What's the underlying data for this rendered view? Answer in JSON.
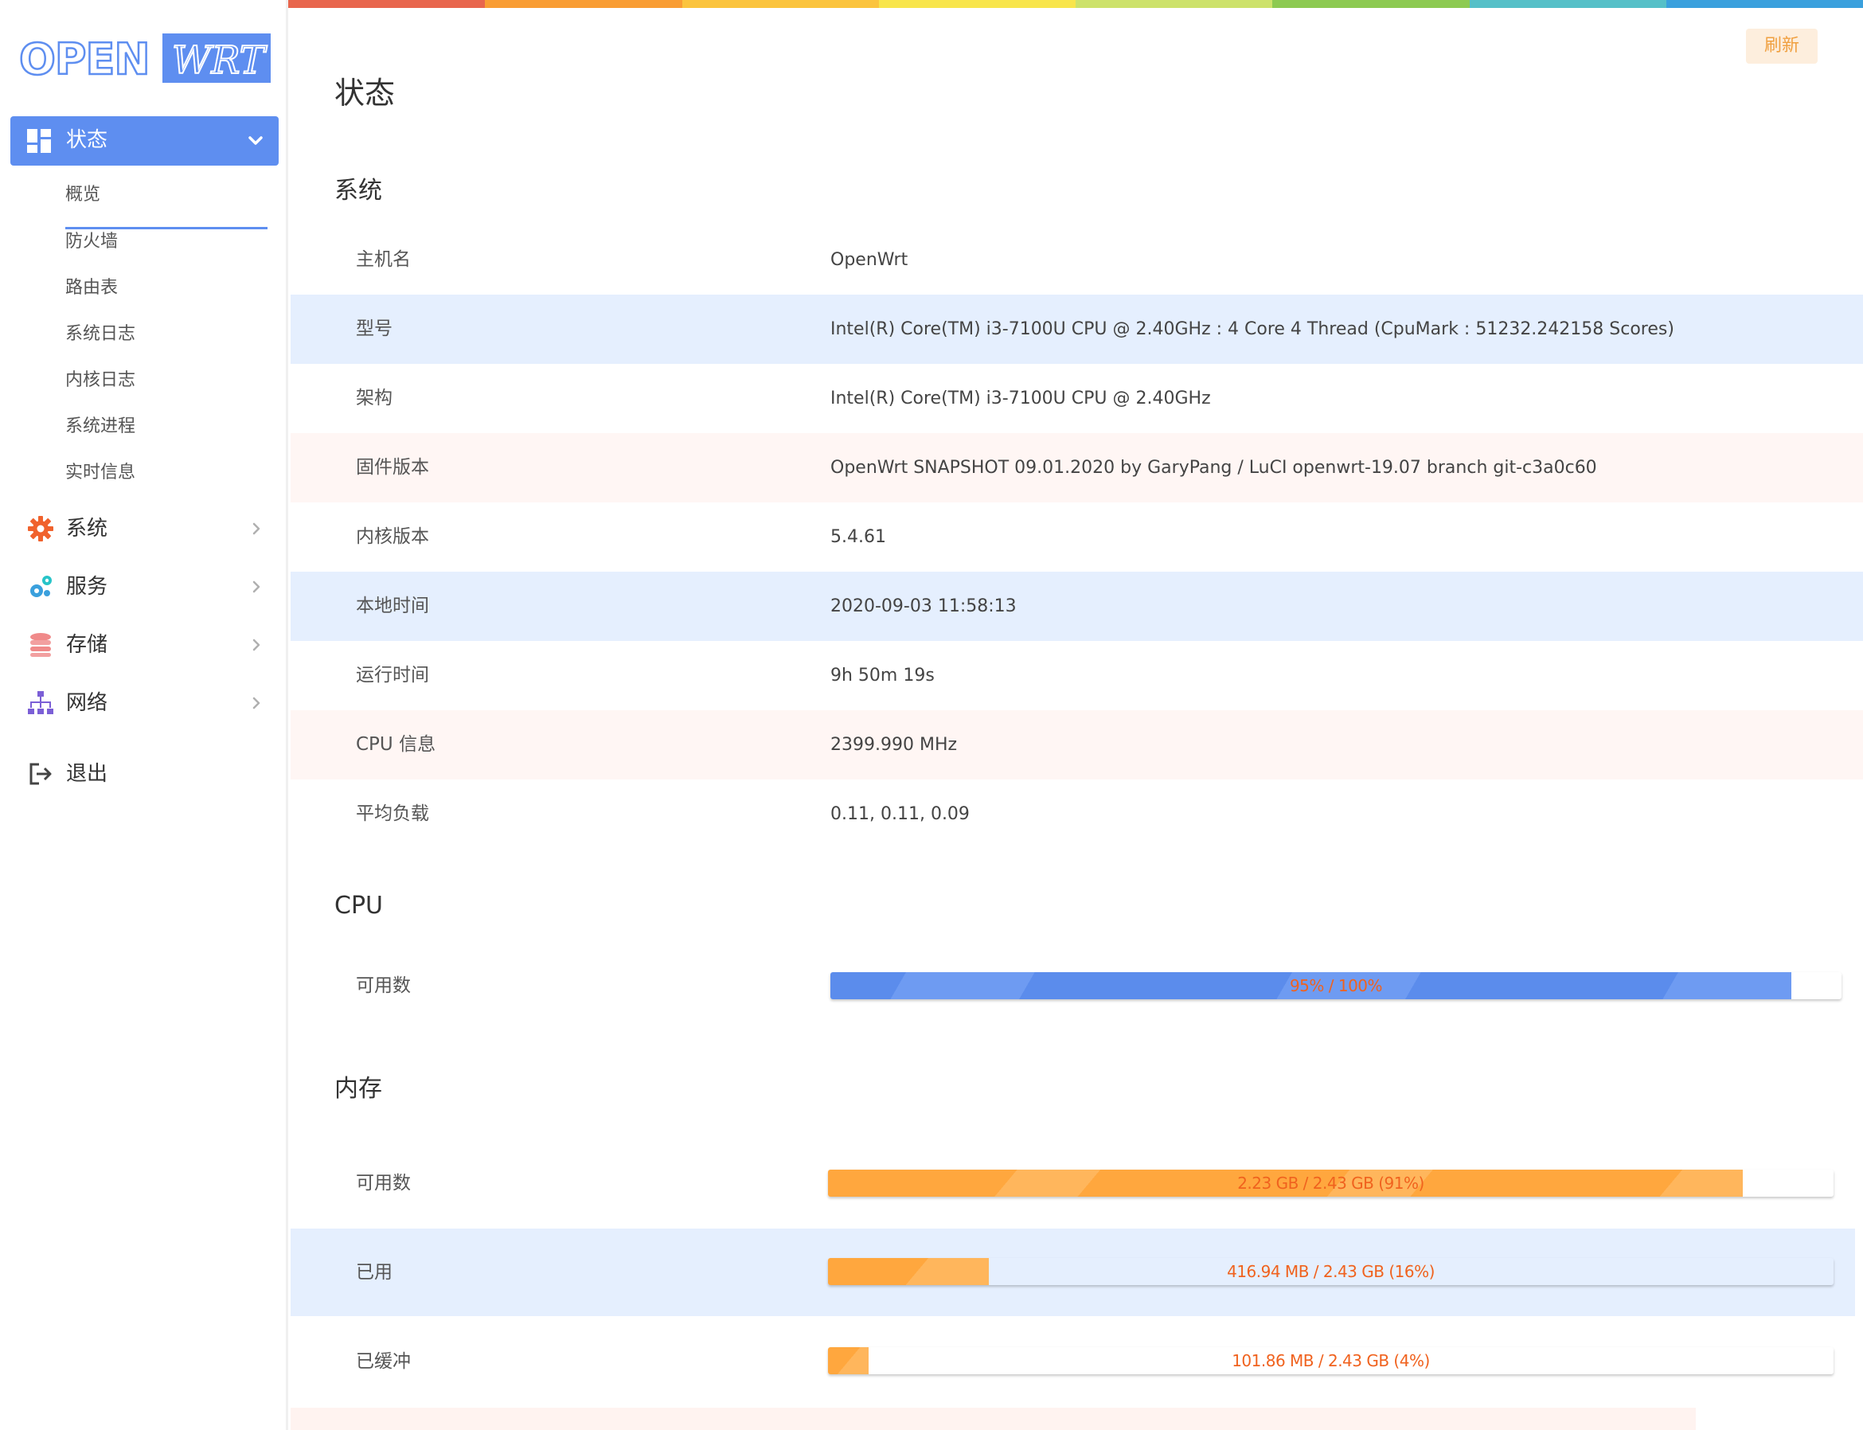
{
  "logo": {
    "left_text": "OPEN",
    "right_text": "WRT"
  },
  "sidebar": {
    "active_section": "状态",
    "sub_items": [
      "概览",
      "防火墙",
      "路由表",
      "系统日志",
      "内核日志",
      "系统进程",
      "实时信息"
    ],
    "items": [
      {
        "label": "系统",
        "icon": "gear-icon"
      },
      {
        "label": "服务",
        "icon": "cogs-icon"
      },
      {
        "label": "存储",
        "icon": "database-icon"
      },
      {
        "label": "网络",
        "icon": "sitemap-icon"
      }
    ],
    "logout": "退出"
  },
  "header": {
    "refresh_label": "刷新",
    "page_title": "状态"
  },
  "system": {
    "title": "系统",
    "rows": [
      {
        "key": "主机名",
        "value": "OpenWrt"
      },
      {
        "key": "型号",
        "value": "Intel(R) Core(TM) i3-7100U CPU @ 2.40GHz : 4 Core 4 Thread (CpuMark : 51232.242158 Scores)"
      },
      {
        "key": "架构",
        "value": "Intel(R) Core(TM) i3-7100U CPU @ 2.40GHz"
      },
      {
        "key": "固件版本",
        "value": "OpenWrt SNAPSHOT 09.01.2020 by GaryPang / LuCI openwrt-19.07 branch git-c3a0c60"
      },
      {
        "key": "内核版本",
        "value": "5.4.61"
      },
      {
        "key": "本地时间",
        "value": "2020-09-03 11:58:13"
      },
      {
        "key": "运行时间",
        "value": "9h 50m 19s"
      },
      {
        "key": "CPU 信息",
        "value": "2399.990 MHz"
      },
      {
        "key": "平均负载",
        "value": "0.11, 0.11, 0.09"
      }
    ]
  },
  "cpu": {
    "title": "CPU",
    "available_label": "可用数",
    "available_text": "95% / 100%",
    "available_fraction": 0.95
  },
  "memory": {
    "title": "内存",
    "rows": [
      {
        "key": "可用数",
        "text": "2.23 GB / 2.43 GB (91%)",
        "fraction": 0.91
      },
      {
        "key": "已用",
        "text": "416.94 MB / 2.43 GB (16%)",
        "fraction": 0.16
      },
      {
        "key": "已缓冲",
        "text": "101.86 MB / 2.43 GB (4%)",
        "fraction": 0.04
      }
    ]
  },
  "colors": {
    "accent": "#5e8ef0",
    "rainbow": [
      "#e8664d",
      "#f99d34",
      "#fbc43e",
      "#f8e54c",
      "#cde26b",
      "#8dca52",
      "#56c0c8",
      "#3aa0dd"
    ]
  }
}
